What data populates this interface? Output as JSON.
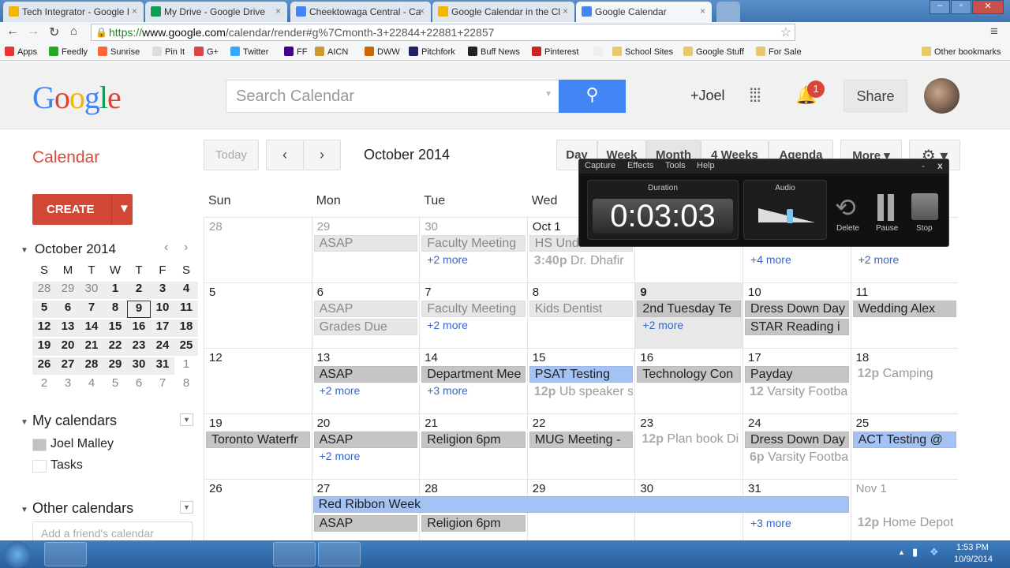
{
  "browser": {
    "tabs": [
      {
        "title": "Tech Integrator - Google I",
        "color": "#f4b400"
      },
      {
        "title": "My Drive - Google Drive",
        "color": "#0f9d58"
      },
      {
        "title": "Cheektowaga Central - Ca",
        "color": "#4285f4"
      },
      {
        "title": "Google Calendar in the Cl",
        "color": "#f4b400"
      },
      {
        "title": "Google Calendar",
        "color": "#4285f4"
      }
    ],
    "url_scheme": "https://",
    "url_host": "www.google.com",
    "url_path": "/calendar/render#g%7Cmonth-3+22844+22881+22857",
    "bookmarks": [
      "Apps",
      "Feedly",
      "Sunrise",
      "Pin It",
      "G+",
      "Twitter",
      "FF",
      "AICN",
      "DWW",
      "Pitchfork",
      "Buff News",
      "Pinterest",
      "",
      "School Sites",
      "Google Stuff",
      "For Sale"
    ],
    "other_bookmarks": "Other bookmarks",
    "chevron": "»"
  },
  "header": {
    "logo": "Google",
    "search_placeholder": "Search Calendar",
    "user": "+Joel",
    "notifications": "1",
    "share": "Share"
  },
  "toolbar": {
    "app_title": "Calendar",
    "today": "Today",
    "month_title": "October 2014",
    "views": [
      "Day",
      "Week",
      "Month",
      "4 Weeks",
      "Agenda"
    ],
    "more": "More ▾",
    "settings": "⚙ ▾"
  },
  "sidebar": {
    "create": "CREATE",
    "mini_title": "October 2014",
    "mini_dow": [
      "S",
      "M",
      "T",
      "W",
      "T",
      "F",
      "S"
    ],
    "mini_weeks": [
      [
        "28",
        "29",
        "30",
        "1",
        "2",
        "3",
        "4"
      ],
      [
        "5",
        "6",
        "7",
        "8",
        "9",
        "10",
        "11"
      ],
      [
        "12",
        "13",
        "14",
        "15",
        "16",
        "17",
        "18"
      ],
      [
        "19",
        "20",
        "21",
        "22",
        "23",
        "24",
        "25"
      ],
      [
        "26",
        "27",
        "28",
        "29",
        "30",
        "31",
        "1"
      ],
      [
        "2",
        "3",
        "4",
        "5",
        "6",
        "7",
        "8"
      ]
    ],
    "my_calendars": "My calendars",
    "calendars": [
      {
        "name": "Joel Malley",
        "color": "#c2c2c2"
      },
      {
        "name": "Tasks",
        "color": "#ffffff"
      }
    ],
    "other_calendars": "Other calendars",
    "add_friend_placeholder": "Add a friend's calendar"
  },
  "grid": {
    "dow": [
      "Sun",
      "Mon",
      "Tue",
      "Wed",
      "Thu",
      "Fri",
      "Sat"
    ],
    "weeks": [
      [
        {
          "d": "28",
          "o": 1
        },
        {
          "d": "29",
          "o": 1,
          "ev": [
            {
              "t": "ASAP",
              "s": "p"
            }
          ]
        },
        {
          "d": "30",
          "o": 1,
          "ev": [
            {
              "t": "Faculty Meeting",
              "s": "p"
            }
          ],
          "more": "+2 more"
        },
        {
          "d": "Oct 1",
          "ev": [
            {
              "t": "HS Und",
              "s": "p"
            },
            {
              "b": "3:40p",
              "t": "Dr. Dhafir",
              "s": "t"
            }
          ]
        },
        {
          "d": ""
        },
        {
          "d": "",
          "more": "+4 more"
        },
        {
          "d": "",
          "more": "+2 more"
        }
      ],
      [
        {
          "d": "5"
        },
        {
          "d": "6",
          "ev": [
            {
              "t": "ASAP",
              "s": "p"
            },
            {
              "t": "Grades Due",
              "s": "p"
            }
          ]
        },
        {
          "d": "7",
          "ev": [
            {
              "t": "Faculty Meeting",
              "s": "p"
            }
          ],
          "more": "+2 more"
        },
        {
          "d": "8",
          "ev": [
            {
              "t": "Kids Dentist",
              "s": "p"
            }
          ]
        },
        {
          "d": "9",
          "today": 1,
          "ev": [
            {
              "t": "2nd Tuesday Te",
              "s": "g"
            }
          ],
          "more": "+2 more"
        },
        {
          "d": "10",
          "ev": [
            {
              "t": "Dress Down Day",
              "s": "g"
            },
            {
              "t": "STAR Reading i",
              "s": "g"
            }
          ]
        },
        {
          "d": "11",
          "ev": [
            {
              "t": "Wedding Alex",
              "s": "g"
            }
          ]
        }
      ],
      [
        {
          "d": "12"
        },
        {
          "d": "13",
          "ev": [
            {
              "t": "ASAP",
              "s": "g"
            }
          ],
          "more": "+2 more"
        },
        {
          "d": "14",
          "ev": [
            {
              "t": "Department Mee",
              "s": "g"
            }
          ],
          "more": "+3 more"
        },
        {
          "d": "15",
          "ev": [
            {
              "t": "PSAT Testing",
              "s": "bl"
            },
            {
              "b": "12p",
              "t": "Ub speaker s",
              "s": "t"
            }
          ]
        },
        {
          "d": "16",
          "ev": [
            {
              "t": "Technology Con",
              "s": "g"
            }
          ]
        },
        {
          "d": "17",
          "ev": [
            {
              "t": "Payday",
              "s": "g"
            },
            {
              "b": "12",
              "t": "Varsity Footba",
              "s": "t"
            }
          ]
        },
        {
          "d": "18",
          "ev": [
            {
              "b": "12p",
              "t": "Camping",
              "s": "t"
            }
          ]
        }
      ],
      [
        {
          "d": "19",
          "ev": [
            {
              "t": "Toronto Waterfr",
              "s": "g"
            }
          ]
        },
        {
          "d": "20",
          "ev": [
            {
              "t": "ASAP",
              "s": "g"
            }
          ],
          "more": "+2 more"
        },
        {
          "d": "21",
          "ev": [
            {
              "t": "Religion 6pm",
              "s": "g"
            }
          ]
        },
        {
          "d": "22",
          "ev": [
            {
              "t": "MUG Meeting -",
              "s": "g"
            }
          ]
        },
        {
          "d": "23",
          "ev": [
            {
              "b": "12p",
              "t": "Plan book Di",
              "s": "t"
            }
          ]
        },
        {
          "d": "24",
          "ev": [
            {
              "t": "Dress Down Day",
              "s": "g"
            },
            {
              "b": "6p",
              "t": "Varsity Footba",
              "s": "t"
            }
          ]
        },
        {
          "d": "25",
          "ev": [
            {
              "t": "ACT Testing @",
              "s": "bl"
            }
          ]
        }
      ],
      [
        {
          "d": "26"
        },
        {
          "d": "27",
          "ev": [
            {
              "t": "",
              "s": "x"
            },
            {
              "t": "ASAP",
              "s": "g"
            }
          ]
        },
        {
          "d": "28",
          "ev": [
            {
              "t": "",
              "s": "x"
            },
            {
              "t": "Religion 6pm",
              "s": "g"
            }
          ]
        },
        {
          "d": "29"
        },
        {
          "d": "30"
        },
        {
          "d": "31",
          "more2": "+3 more"
        },
        {
          "d": "Nov 1",
          "o": 1,
          "ev": [
            {
              "t": "",
              "s": "x"
            },
            {
              "b": "12p",
              "t": "Home Depot",
              "s": "t"
            }
          ]
        }
      ]
    ],
    "red_ribbon": "Red Ribbon Week"
  },
  "recorder": {
    "menu": [
      "Capture",
      "Effects",
      "Tools",
      "Help"
    ],
    "duration_label": "Duration",
    "duration": "0:03:03",
    "audio_label": "Audio",
    "audio_level": 0.55,
    "delete": "Delete",
    "pause": "Pause",
    "stop": "Stop",
    "minimize": "-",
    "close": "x"
  },
  "taskbar": {
    "time": "1:53 PM",
    "date": "10/9/2014"
  }
}
